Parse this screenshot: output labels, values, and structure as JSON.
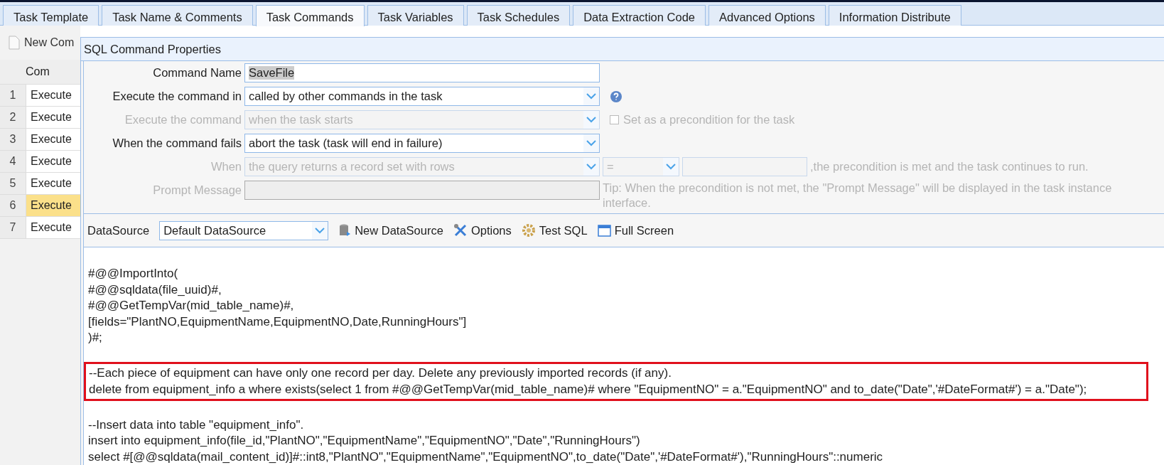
{
  "tabs": [
    {
      "label": "Task Template",
      "selected": false
    },
    {
      "label": "Task Name & Comments",
      "selected": false
    },
    {
      "label": "Task Commands",
      "selected": true
    },
    {
      "label": "Task Variables",
      "selected": false
    },
    {
      "label": "Task Schedules",
      "selected": false
    },
    {
      "label": "Data Extraction Code",
      "selected": false
    },
    {
      "label": "Advanced Options",
      "selected": false
    },
    {
      "label": "Information Distribute",
      "selected": false
    }
  ],
  "toolbar": {
    "new_button": "New Com"
  },
  "grid": {
    "column_header": "Com",
    "rows": [
      {
        "number": "1",
        "command": "Execute",
        "selected": false
      },
      {
        "number": "2",
        "command": "Execute",
        "selected": false
      },
      {
        "number": "3",
        "command": "Execute",
        "selected": false
      },
      {
        "number": "4",
        "command": "Execute",
        "selected": false
      },
      {
        "number": "5",
        "command": "Execute",
        "selected": false
      },
      {
        "number": "6",
        "command": "Execute",
        "selected": true
      },
      {
        "number": "7",
        "command": "Execute",
        "selected": false
      }
    ]
  },
  "dialog": {
    "title": "SQL Command Properties",
    "rows": [
      {
        "kind": "text",
        "label": "Command Name",
        "value": "SaveFile",
        "disabled": false
      },
      {
        "kind": "select",
        "label": "Execute the command in",
        "value": "called by other commands in the task",
        "disabled": false,
        "extra": {
          "kind": "help"
        }
      },
      {
        "kind": "select",
        "label": "Execute the command",
        "value": "when the task starts",
        "disabled": true,
        "extra": {
          "kind": "checkbox",
          "label": "Set as a precondition for the task",
          "checked": false,
          "disabled": true
        }
      },
      {
        "kind": "select",
        "label": "When the command fails",
        "value": "abort the task (task will end in failure)",
        "disabled": false
      },
      {
        "kind": "condition",
        "label": "When",
        "value": "the query returns a record set with rows",
        "operator": "=",
        "suffix": ",the precondition is met and the task continues to run.",
        "disabled": true
      },
      {
        "kind": "text",
        "label": "Prompt Message",
        "disabled": true,
        "tip": "Tip: When the precondition is not met, the \"Prompt Message\" will be displayed in the task instance interface."
      }
    ],
    "datasource": {
      "label": "DataSource",
      "value": "Default DataSource"
    },
    "actions": [
      {
        "kind": "database",
        "label": "New DataSource"
      },
      {
        "kind": "tools",
        "label": "Options"
      },
      {
        "kind": "gear",
        "label": "Test SQL"
      },
      {
        "kind": "window",
        "label": "Full Screen"
      }
    ],
    "code": [
      {
        "highlighted": false,
        "lines": [
          "#@@ImportInto(",
          "#@@sqldata(file_uuid)#,",
          "#@@GetTempVar(mid_table_name)#,",
          "[fields=\"PlantNO,EquipmentName,EquipmentNO,Date,RunningHours\"]",
          ")#;"
        ]
      },
      {
        "highlighted": true,
        "lines": [
          "--Each piece of equipment can have only one record per day. Delete any previously imported records (if any).",
          "delete from equipment_info a where exists(select 1 from #@@GetTempVar(mid_table_name)# where \"EquipmentNO\" = a.\"EquipmentNO\" and to_date(\"Date\",'#DateFormat#') = a.\"Date\");"
        ]
      },
      {
        "highlighted": false,
        "lines": [
          "--Insert data into table \"equipment_info\".",
          "insert into equipment_info(file_id,\"PlantNO\",\"EquipmentName\",\"EquipmentNO\",\"Date\",\"RunningHours\")",
          "select #[@@sqldata(mail_content_id)]#::int8,\"PlantNO\",\"EquipmentName\",\"EquipmentNO\",to_date(\"Date\",'#DateFormat#'),\"RunningHours\"::numeric"
        ]
      }
    ]
  }
}
